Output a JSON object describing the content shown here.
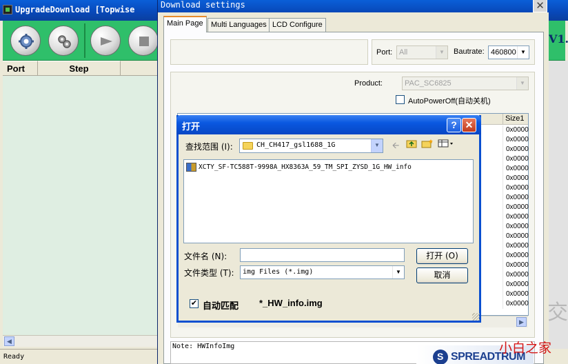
{
  "main_window": {
    "title": "UpgradeDownload [Topwise",
    "version_text": "V1.",
    "toolbar_buttons": [
      {
        "name": "load-packet",
        "icon": "gear-icon"
      },
      {
        "name": "settings",
        "icon": "gears-icon"
      },
      {
        "name": "start",
        "icon": "play-icon"
      },
      {
        "name": "stop",
        "icon": "stop-icon"
      }
    ],
    "table_headers": [
      "Port",
      "Step"
    ],
    "status": "Ready"
  },
  "settings_dialog": {
    "title": "Download settings",
    "tabs": [
      "Main Page",
      "Multi Languages",
      "LCD Configure"
    ],
    "active_tab": 0,
    "port_label": "Port:",
    "port_value": "All",
    "baudrate_label": "Bautrate:",
    "baudrate_value": "460800",
    "product_label": "Product:",
    "product_value": "PAC_SC6825",
    "autopoweroff_label": "AutoPowerOff(自动关机)",
    "autopoweroff_checked": false,
    "size_header": "Size1",
    "size_values": [
      "0x0000",
      "0x0000",
      "0x0000",
      "0x0000",
      "0x0000",
      "0x0000",
      "0x0000",
      "0x0000",
      "0x0000",
      "0x0000",
      "0x0000",
      "0x0000",
      "0x0000",
      "0x0000",
      "0x0000",
      "0x0000",
      "0x0000",
      "0x0000",
      "0x0000"
    ],
    "note": "Note: HWInfoImg",
    "brand": "SPREADTRUM"
  },
  "open_dialog": {
    "title": "打开",
    "help_glyph": "?",
    "close_glyph": "✕",
    "lookin_label": "查找范围 (I):",
    "lookin_value": "CH_CH417_gsl1688_1G",
    "files": [
      "XCTY_SF-TC588T-9998A_HX8363A_59_TM_SPI_ZYSD_1G_HW_info"
    ],
    "filename_label": "文件名 (N):",
    "filename_value": "",
    "filetype_label": "文件类型 (T):",
    "filetype_value": "img Files (*.img)",
    "ok_label": "打开 (O)",
    "cancel_label": "取消",
    "automatch_label": "自动匹配",
    "automatch_checked": true,
    "automatch_pattern": "*_HW_info.img"
  },
  "watermark": {
    "char": "交",
    "text": "小白之家"
  },
  "colors": {
    "toolbar_green": "#2fbf6a",
    "titlebar_blue": "#0a58e0",
    "watermark_red": "#d41515"
  }
}
